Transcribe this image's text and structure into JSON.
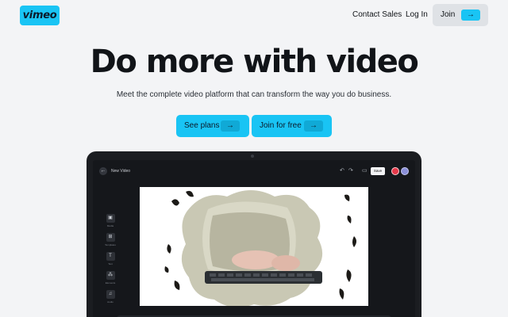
{
  "header": {
    "logo_text": "vimeo",
    "nav": {
      "contact_sales": "Contact Sales",
      "log_in": "Log In"
    },
    "join_label": "Join",
    "join_arrow": "→"
  },
  "hero": {
    "title": "Do more with video",
    "subtitle": "Meet the complete video platform that can transform the way you do business.",
    "cta_plans": {
      "label": "See plans",
      "arrow": "→"
    },
    "cta_free": {
      "label": "Join for free",
      "arrow": "→"
    }
  },
  "editor": {
    "back_icon": "←",
    "title": "New Video",
    "toolbar": {
      "undo_icon": "↶",
      "redo_icon": "↷",
      "comment_icon": "▭",
      "save_label": "Save"
    },
    "tools": [
      {
        "icon": "image-icon",
        "glyph": "▣",
        "label": "Media"
      },
      {
        "icon": "template-icon",
        "glyph": "⊞",
        "label": "Templates"
      },
      {
        "icon": "text-icon",
        "glyph": "T",
        "label": "Text"
      },
      {
        "icon": "elements-icon",
        "glyph": "⁂",
        "label": "Elements"
      },
      {
        "icon": "audio-icon",
        "glyph": "♫",
        "label": "Audio"
      }
    ]
  },
  "colors": {
    "brand": "#19c4f4",
    "background": "#f3f4f6",
    "laptop_frame": "#1b1d21"
  }
}
